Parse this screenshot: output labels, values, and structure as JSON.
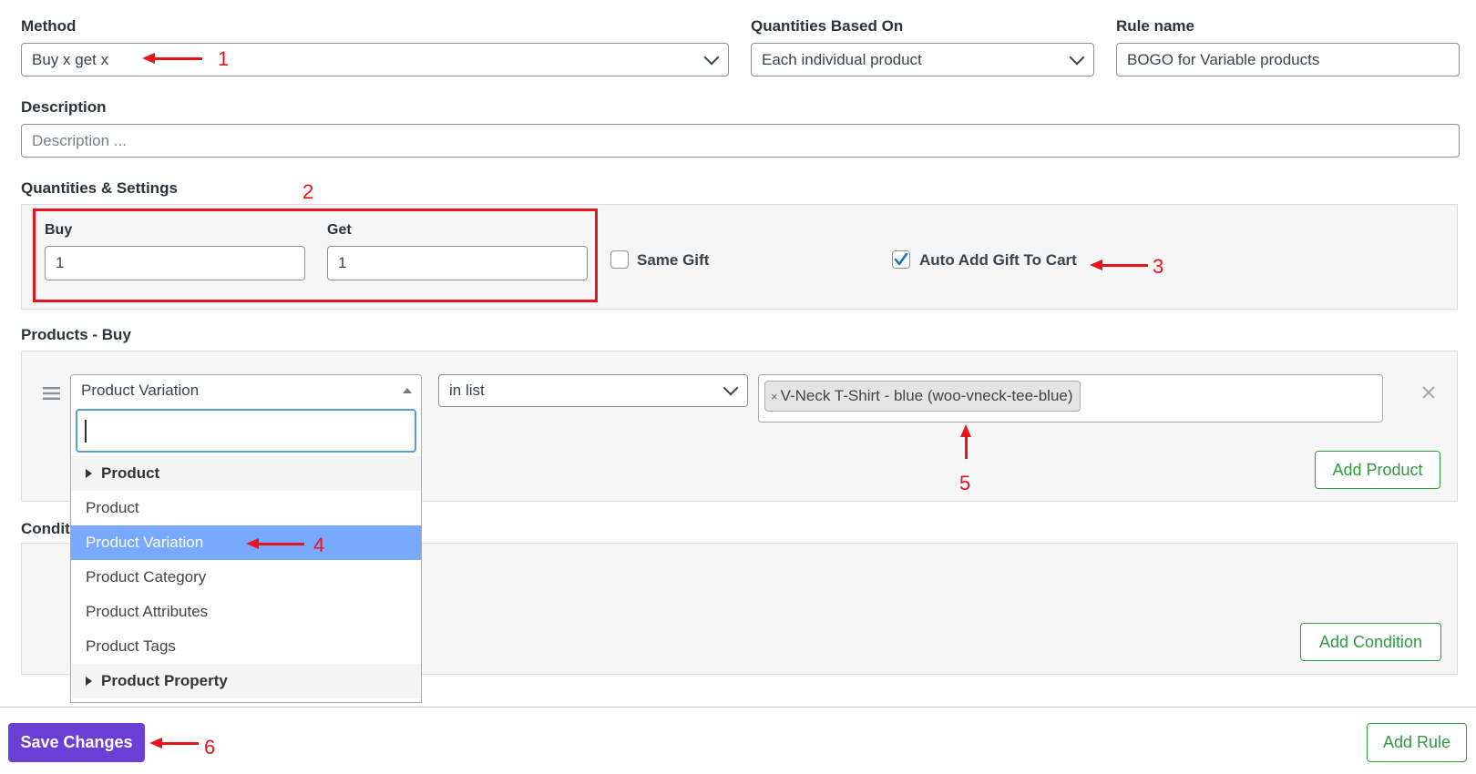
{
  "method": {
    "label": "Method",
    "value": "Buy x get x"
  },
  "quantities_based_on": {
    "label": "Quantities Based On",
    "value": "Each individual product"
  },
  "rule_name": {
    "label": "Rule name",
    "value": "BOGO for Variable products"
  },
  "description": {
    "label": "Description",
    "placeholder": "Description ..."
  },
  "quantities_settings": {
    "heading": "Quantities & Settings",
    "buy_label": "Buy",
    "buy_value": "1",
    "get_label": "Get",
    "get_value": "1",
    "same_gift_label": "Same Gift",
    "same_gift_checked": false,
    "auto_add_label": "Auto Add Gift To Cart",
    "auto_add_checked": true
  },
  "products_buy": {
    "heading": "Products - Buy",
    "type_value": "Product Variation",
    "operator_value": "in list",
    "selected_tag": "V-Neck T-Shirt - blue (woo-vneck-tee-blue)",
    "remove_symbol": "×",
    "add_product_label": "Add Product"
  },
  "conditions": {
    "heading": "Condit",
    "add_condition_label": "Add Condition"
  },
  "dropdown": {
    "search_value": "",
    "items": [
      {
        "label": "Product",
        "kind": "group"
      },
      {
        "label": "Product",
        "kind": "option"
      },
      {
        "label": "Product Variation",
        "kind": "selected"
      },
      {
        "label": "Product Category",
        "kind": "option"
      },
      {
        "label": "Product Attributes",
        "kind": "option"
      },
      {
        "label": "Product Tags",
        "kind": "option"
      },
      {
        "label": "Product Property",
        "kind": "group"
      }
    ]
  },
  "footer": {
    "save_label": "Save Changes",
    "add_rule_label": "Add Rule"
  },
  "annotations": [
    "1",
    "2",
    "3",
    "4",
    "5",
    "6"
  ],
  "colors": {
    "primary": "#6b3fd6",
    "success": "#2e9c3e",
    "annotation": "#e8141b",
    "highlight": "#79a8ff"
  }
}
